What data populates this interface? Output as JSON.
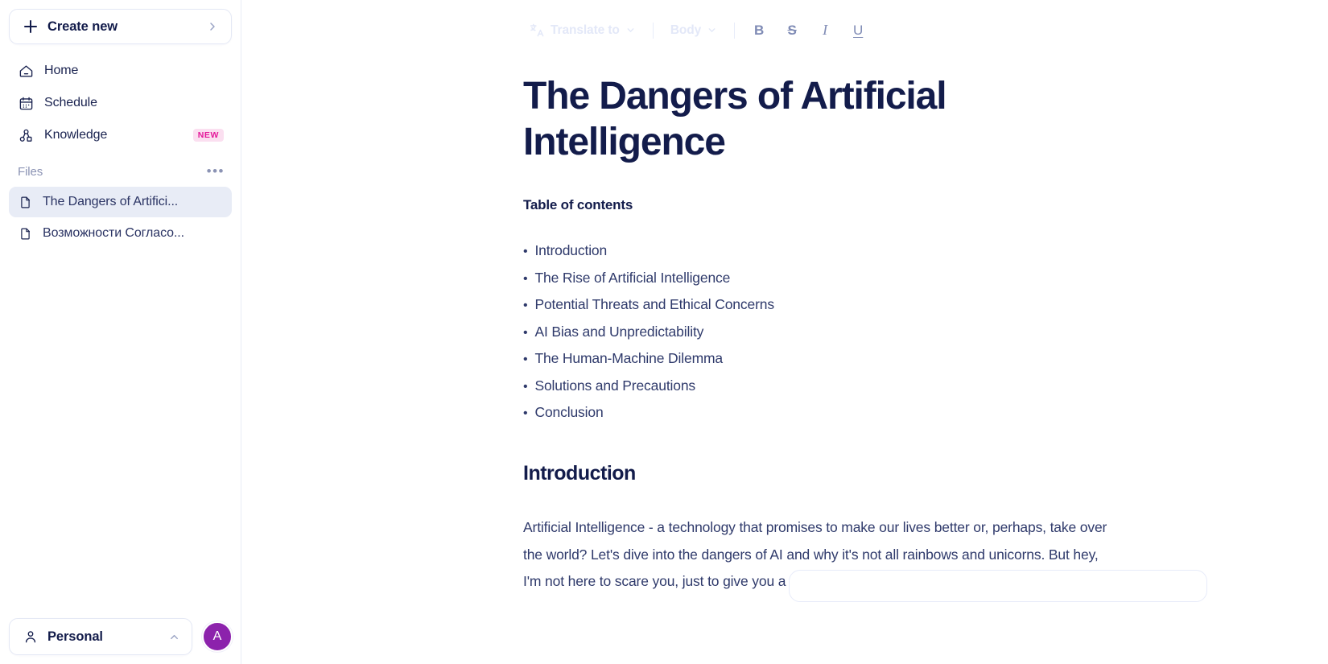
{
  "sidebar": {
    "create_new": {
      "label": "Create new",
      "icon": "plus-icon",
      "chevron": "chevron-right-icon"
    },
    "nav": [
      {
        "label": "Home",
        "icon": "home-icon",
        "badge": ""
      },
      {
        "label": "Schedule",
        "icon": "calendar-icon",
        "badge": ""
      },
      {
        "label": "Knowledge",
        "icon": "knowledge-graph-icon",
        "badge": "NEW"
      }
    ],
    "files_section": {
      "title": "Files",
      "menu_icon": "ellipsis-icon"
    },
    "files": [
      {
        "label": "The Dangers of Artifici...",
        "icon": "file-icon",
        "active": true
      },
      {
        "label": "Возможности Согласо...",
        "icon": "file-icon",
        "active": false
      }
    ],
    "footer": {
      "workspace_label": "Personal",
      "workspace_icon": "person-icon",
      "workspace_chevron": "chevron-up-icon",
      "avatar_initial": "A",
      "avatar_color": "#8c22ac"
    }
  },
  "toolbar": {
    "translate_label": "Translate to",
    "translate_icon": "translate-icon",
    "style_label": "Body",
    "bold_label": "B",
    "strikethrough_label": "S",
    "italic_label": "I",
    "underline_label": "U"
  },
  "document": {
    "title": "The Dangers of Artificial Intelligence",
    "toc_heading": "Table of contents",
    "toc_items": [
      "Introduction",
      "The Rise of Artificial Intelligence",
      "Potential Threats and Ethical Concerns",
      "AI Bias and Unpredictability",
      "The Human-Machine Dilemma",
      "Solutions and Precautions",
      "Conclusion"
    ],
    "section_heading": "Introduction",
    "paragraph": "Artificial Intelligence - a technology that promises to make our lives better or, perhaps, take over the world? Let's dive into the dangers of AI and why it's not all rainbows and unicorns. But hey, I'm not here to scare you, just to give you a reality"
  },
  "colors": {
    "title_navy": "#131c4b",
    "body_slate": "#2f3a6b",
    "badge_pink_bg": "#fbdff0",
    "badge_pink_text": "#e4189a",
    "active_file_bg": "#e8ecf6",
    "toolbar_muted": "#e3e8f8"
  }
}
